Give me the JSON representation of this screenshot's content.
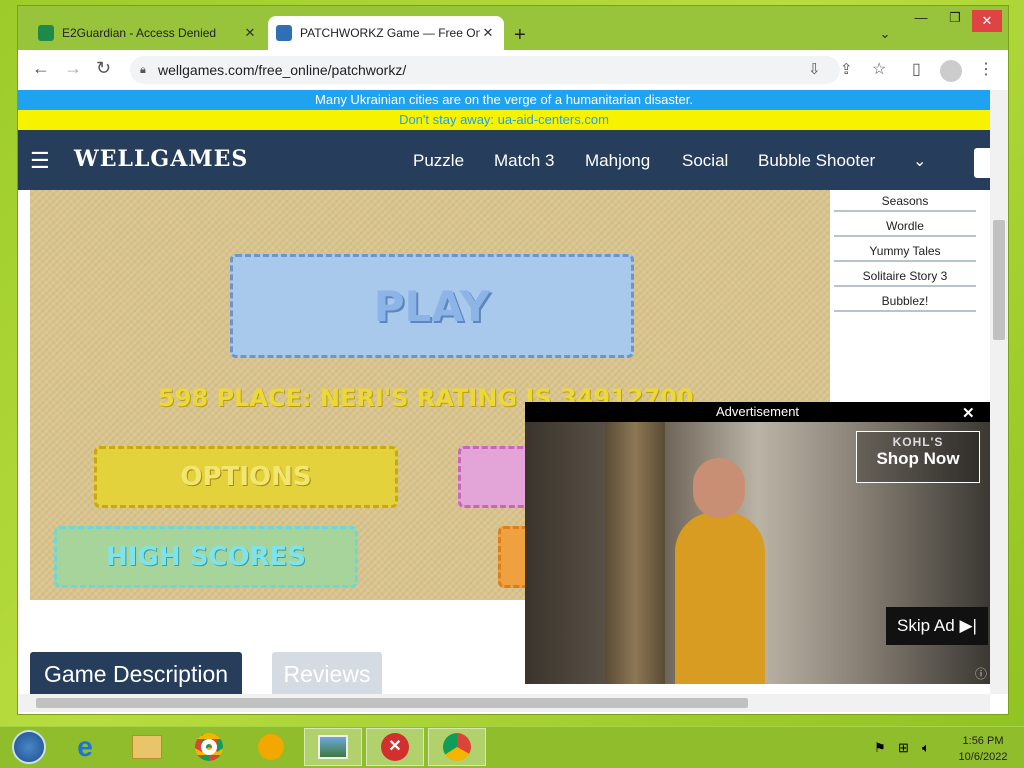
{
  "browser": {
    "tabs": [
      {
        "title": "E2Guardian - Access Denied"
      },
      {
        "title": "PATCHWORKZ Game — Free Online"
      }
    ],
    "url": "wellgames.com/free_online/patchworkz/"
  },
  "banner": {
    "line1": "Many Ukrainian cities are on the verge of a humanitarian disaster.",
    "line2": "Don't stay away: ua-aid-centers.com"
  },
  "nav": {
    "logo": "WELLGAMES",
    "links": [
      "Puzzle",
      "Match 3",
      "Mahjong",
      "Social",
      "Bubble Shooter"
    ]
  },
  "game": {
    "play_label": "PLAY",
    "rating_text": "598 PLACE: NERI'S RATING IS 34912700",
    "options_label": "OPTIONS",
    "highscores_label": "HIGH SCORES"
  },
  "sidebar": {
    "items": [
      "Seasons",
      "Wordle",
      "Yummy Tales",
      "Solitaire Story 3",
      "Bubblez!"
    ]
  },
  "page_tabs": {
    "description": "Game Description",
    "reviews": "Reviews"
  },
  "ad": {
    "header": "Advertisement",
    "brand": "KOHL'S",
    "shop_now": "Shop Now",
    "skip": "Skip Ad"
  },
  "taskbar": {
    "time": "1:56 PM",
    "date": "10/6/2022"
  },
  "colors": {
    "nav_bg": "#263e5c",
    "banner_blue": "#1fa2ef",
    "banner_yellow": "#f7f200",
    "desktop_green": "#9ccc2a"
  }
}
